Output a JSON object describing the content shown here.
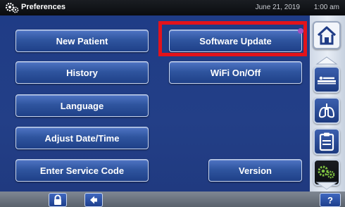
{
  "header": {
    "title": "Preferences",
    "date": "June 21, 2019",
    "time": "1:00 am",
    "icon": "gears-icon"
  },
  "buttons": {
    "new_patient": "New Patient",
    "history": "History",
    "language": "Language",
    "adjust_date_time": "Adjust Date/Time",
    "enter_service_code": "Enter Service Code",
    "software_update": "Software Update",
    "wifi": "WiFi On/Off",
    "version": "Version"
  },
  "sidebar": {
    "items": [
      {
        "icon": "home-icon"
      },
      {
        "icon": "patient-bed-icon"
      },
      {
        "icon": "lungs-icon"
      },
      {
        "icon": "clipboard-icon"
      },
      {
        "icon": "gears-icon",
        "active": true
      }
    ]
  },
  "footer": {
    "lock_icon": "lock-icon",
    "back_icon": "back-arrow-icon",
    "help_label": "?"
  },
  "colors": {
    "panel": "#233f87",
    "button": "#2f559f",
    "highlight": "#e3131b",
    "notification_dot": "#a44fc0"
  }
}
